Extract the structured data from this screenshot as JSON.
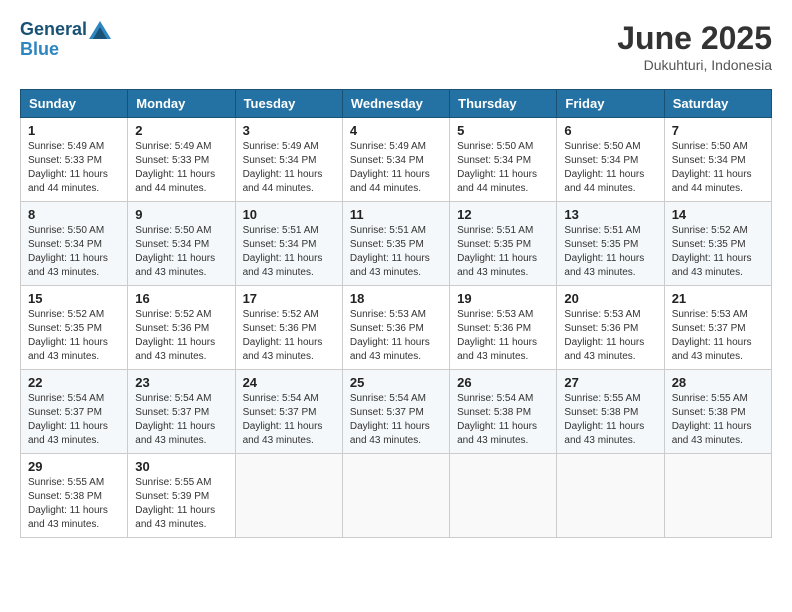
{
  "header": {
    "logo_line1": "General",
    "logo_line2": "Blue",
    "month": "June 2025",
    "location": "Dukuhturi, Indonesia"
  },
  "days_of_week": [
    "Sunday",
    "Monday",
    "Tuesday",
    "Wednesday",
    "Thursday",
    "Friday",
    "Saturday"
  ],
  "weeks": [
    [
      {
        "day": 1,
        "sunrise": "5:49 AM",
        "sunset": "5:33 PM",
        "daylight": "11 hours and 44 minutes."
      },
      {
        "day": 2,
        "sunrise": "5:49 AM",
        "sunset": "5:33 PM",
        "daylight": "11 hours and 44 minutes."
      },
      {
        "day": 3,
        "sunrise": "5:49 AM",
        "sunset": "5:34 PM",
        "daylight": "11 hours and 44 minutes."
      },
      {
        "day": 4,
        "sunrise": "5:49 AM",
        "sunset": "5:34 PM",
        "daylight": "11 hours and 44 minutes."
      },
      {
        "day": 5,
        "sunrise": "5:50 AM",
        "sunset": "5:34 PM",
        "daylight": "11 hours and 44 minutes."
      },
      {
        "day": 6,
        "sunrise": "5:50 AM",
        "sunset": "5:34 PM",
        "daylight": "11 hours and 44 minutes."
      },
      {
        "day": 7,
        "sunrise": "5:50 AM",
        "sunset": "5:34 PM",
        "daylight": "11 hours and 44 minutes."
      }
    ],
    [
      {
        "day": 8,
        "sunrise": "5:50 AM",
        "sunset": "5:34 PM",
        "daylight": "11 hours and 43 minutes."
      },
      {
        "day": 9,
        "sunrise": "5:50 AM",
        "sunset": "5:34 PM",
        "daylight": "11 hours and 43 minutes."
      },
      {
        "day": 10,
        "sunrise": "5:51 AM",
        "sunset": "5:34 PM",
        "daylight": "11 hours and 43 minutes."
      },
      {
        "day": 11,
        "sunrise": "5:51 AM",
        "sunset": "5:35 PM",
        "daylight": "11 hours and 43 minutes."
      },
      {
        "day": 12,
        "sunrise": "5:51 AM",
        "sunset": "5:35 PM",
        "daylight": "11 hours and 43 minutes."
      },
      {
        "day": 13,
        "sunrise": "5:51 AM",
        "sunset": "5:35 PM",
        "daylight": "11 hours and 43 minutes."
      },
      {
        "day": 14,
        "sunrise": "5:52 AM",
        "sunset": "5:35 PM",
        "daylight": "11 hours and 43 minutes."
      }
    ],
    [
      {
        "day": 15,
        "sunrise": "5:52 AM",
        "sunset": "5:35 PM",
        "daylight": "11 hours and 43 minutes."
      },
      {
        "day": 16,
        "sunrise": "5:52 AM",
        "sunset": "5:36 PM",
        "daylight": "11 hours and 43 minutes."
      },
      {
        "day": 17,
        "sunrise": "5:52 AM",
        "sunset": "5:36 PM",
        "daylight": "11 hours and 43 minutes."
      },
      {
        "day": 18,
        "sunrise": "5:53 AM",
        "sunset": "5:36 PM",
        "daylight": "11 hours and 43 minutes."
      },
      {
        "day": 19,
        "sunrise": "5:53 AM",
        "sunset": "5:36 PM",
        "daylight": "11 hours and 43 minutes."
      },
      {
        "day": 20,
        "sunrise": "5:53 AM",
        "sunset": "5:36 PM",
        "daylight": "11 hours and 43 minutes."
      },
      {
        "day": 21,
        "sunrise": "5:53 AM",
        "sunset": "5:37 PM",
        "daylight": "11 hours and 43 minutes."
      }
    ],
    [
      {
        "day": 22,
        "sunrise": "5:54 AM",
        "sunset": "5:37 PM",
        "daylight": "11 hours and 43 minutes."
      },
      {
        "day": 23,
        "sunrise": "5:54 AM",
        "sunset": "5:37 PM",
        "daylight": "11 hours and 43 minutes."
      },
      {
        "day": 24,
        "sunrise": "5:54 AM",
        "sunset": "5:37 PM",
        "daylight": "11 hours and 43 minutes."
      },
      {
        "day": 25,
        "sunrise": "5:54 AM",
        "sunset": "5:37 PM",
        "daylight": "11 hours and 43 minutes."
      },
      {
        "day": 26,
        "sunrise": "5:54 AM",
        "sunset": "5:38 PM",
        "daylight": "11 hours and 43 minutes."
      },
      {
        "day": 27,
        "sunrise": "5:55 AM",
        "sunset": "5:38 PM",
        "daylight": "11 hours and 43 minutes."
      },
      {
        "day": 28,
        "sunrise": "5:55 AM",
        "sunset": "5:38 PM",
        "daylight": "11 hours and 43 minutes."
      }
    ],
    [
      {
        "day": 29,
        "sunrise": "5:55 AM",
        "sunset": "5:38 PM",
        "daylight": "11 hours and 43 minutes."
      },
      {
        "day": 30,
        "sunrise": "5:55 AM",
        "sunset": "5:39 PM",
        "daylight": "11 hours and 43 minutes."
      },
      null,
      null,
      null,
      null,
      null
    ]
  ]
}
